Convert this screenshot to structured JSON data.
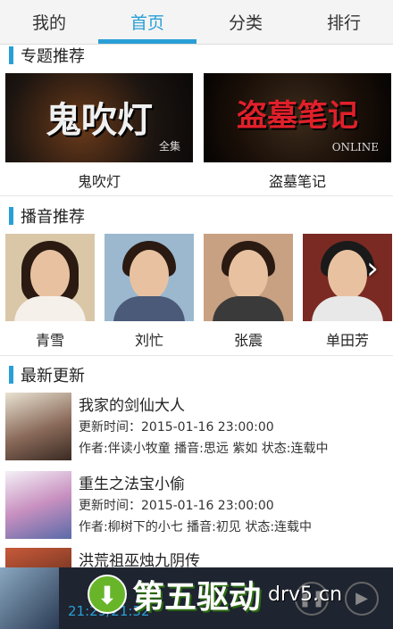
{
  "tabs": [
    {
      "label": "我的"
    },
    {
      "label": "首页"
    },
    {
      "label": "分类"
    },
    {
      "label": "排行"
    }
  ],
  "sections": {
    "topics": "专题推荐",
    "hosts": "播音推荐",
    "latest": "最新更新"
  },
  "topics": [
    {
      "caption": "鬼吹灯",
      "image_text": "鬼吹灯",
      "image_sub": "全集"
    },
    {
      "caption": "盗墓笔记",
      "image_text": "盗墓笔记",
      "image_sub": "ONLINE"
    }
  ],
  "hosts": [
    {
      "name": "青雪"
    },
    {
      "name": "刘忙"
    },
    {
      "name": "张震"
    },
    {
      "name": "单田芳"
    }
  ],
  "news": [
    {
      "title": "我家的剑仙大人",
      "time": "更新时间：2015-01-16 23:00:00",
      "meta": "作者:伴读小牧童   播音:思远 紫如   状态:连载中"
    },
    {
      "title": "重生之法宝小偷",
      "time": "更新时间：2015-01-16 23:00:00",
      "meta": "作者:柳树下的小七   播音:初见   状态:连载中"
    },
    {
      "title": "洪荒祖巫烛九阴传"
    }
  ],
  "player": {
    "time": "21:29/21:32"
  },
  "watermark": {
    "brand": "第五驱动",
    "domain": "drv5.cn"
  },
  "colors": {
    "accent": "#2a9fd6",
    "watermark_green": "#68b52a"
  }
}
